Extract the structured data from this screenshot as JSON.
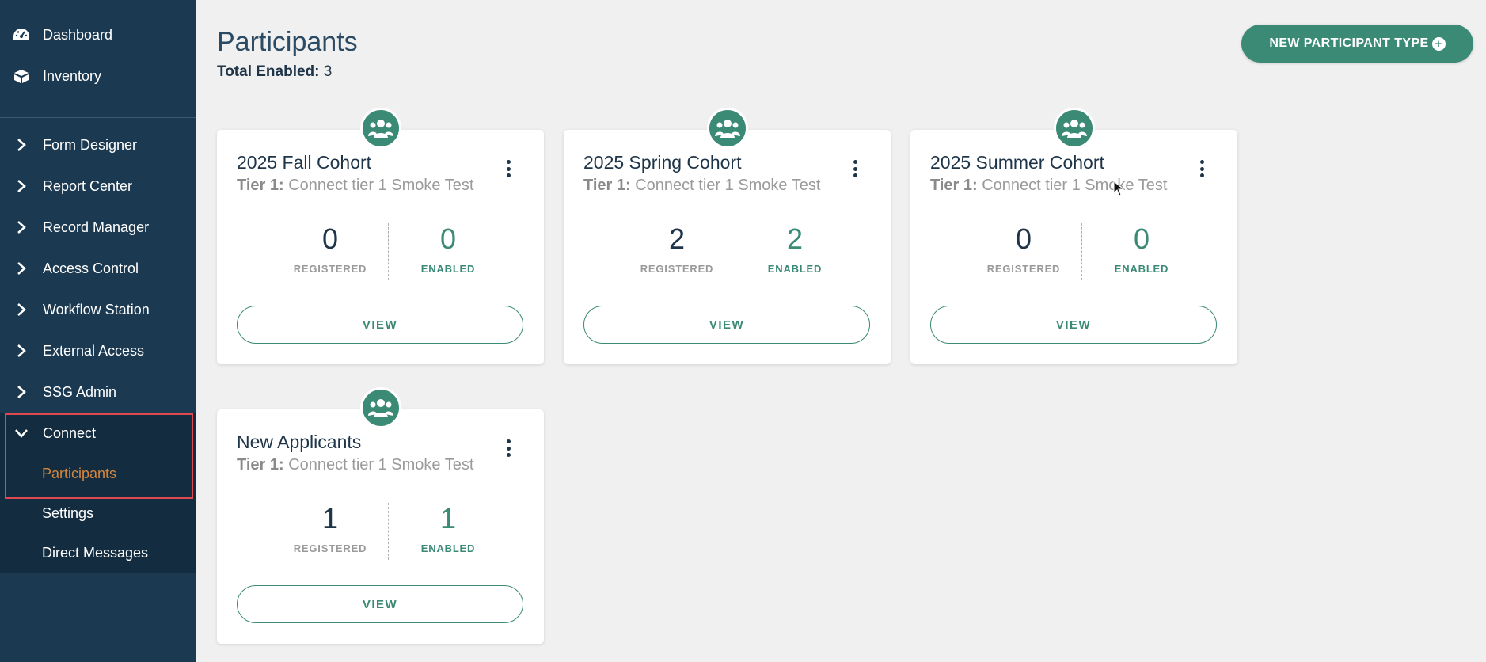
{
  "sidebar": {
    "top_items": [
      {
        "label": "Dashboard",
        "icon": "dashboard-icon"
      },
      {
        "label": "Inventory",
        "icon": "inventory-icon"
      }
    ],
    "nav_items": [
      {
        "label": "Form Designer"
      },
      {
        "label": "Report Center"
      },
      {
        "label": "Record Manager"
      },
      {
        "label": "Access Control"
      },
      {
        "label": "Workflow Station"
      },
      {
        "label": "External Access"
      },
      {
        "label": "SSG Admin"
      }
    ],
    "connect": {
      "label": "Connect",
      "sub_items": [
        "Participants",
        "Settings",
        "Direct Messages"
      ],
      "active": "Participants"
    }
  },
  "header": {
    "title": "Participants",
    "total_label": "Total Enabled:",
    "total_value": "3",
    "new_button": "NEW PARTICIPANT TYPE"
  },
  "cards": [
    {
      "title": "2025 Fall Cohort",
      "tier_label": "Tier 1:",
      "tier_value": "Connect tier 1 Smoke Test",
      "registered": "0",
      "enabled": "0",
      "registered_label": "REGISTERED",
      "enabled_label": "ENABLED",
      "view_label": "VIEW"
    },
    {
      "title": "2025 Spring Cohort",
      "tier_label": "Tier 1:",
      "tier_value": "Connect tier 1 Smoke Test",
      "registered": "2",
      "enabled": "2",
      "registered_label": "REGISTERED",
      "enabled_label": "ENABLED",
      "view_label": "VIEW"
    },
    {
      "title": "2025 Summer Cohort",
      "tier_label": "Tier 1:",
      "tier_value": "Connect tier 1 Smoke Test",
      "registered": "0",
      "enabled": "0",
      "registered_label": "REGISTERED",
      "enabled_label": "ENABLED",
      "view_label": "VIEW"
    },
    {
      "title": "New Applicants",
      "tier_label": "Tier 1:",
      "tier_value": "Connect tier 1 Smoke Test",
      "registered": "1",
      "enabled": "1",
      "registered_label": "REGISTERED",
      "enabled_label": "ENABLED",
      "view_label": "VIEW"
    }
  ],
  "colors": {
    "sidebar_bg": "#1b3a52",
    "accent": "#3b8a76",
    "active_nav": "#d4873d",
    "highlight_border": "#e0484f"
  }
}
